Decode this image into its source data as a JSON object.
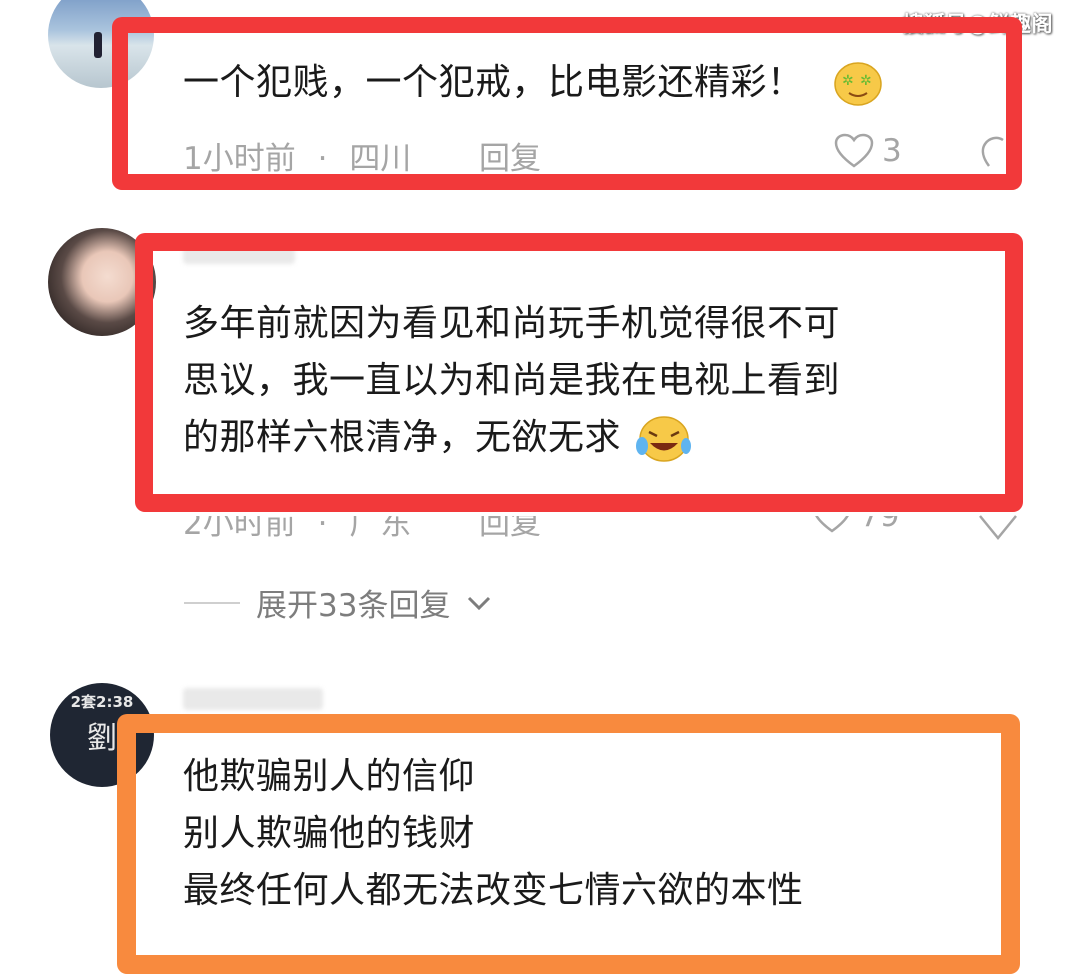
{
  "watermark": "搜狐号@鲜趣阁",
  "comments": [
    {
      "text": "一个犯贱，一个犯戒，比电影还精彩！",
      "time": "1小时前",
      "location": "四川",
      "reply_label": "回复",
      "likes": "3"
    },
    {
      "lines": [
        "多年前就因为看见和尚玩手机觉得很不可",
        "思议，我一直以为和尚是我在电视上看到",
        "的那样六根清净，无欲无求"
      ],
      "time": "2小时前",
      "location": "广东",
      "reply_label": "回复",
      "likes": "79"
    },
    {
      "lines": [
        "他欺骗别人的信仰",
        "别人欺骗他的钱财",
        "最终任何人都无法改变七情六欲的本性"
      ]
    }
  ],
  "expand_label": "展开33条回复",
  "avatar3": {
    "top_text": "2套2:38",
    "char": "劉"
  },
  "colors": {
    "highlight_red": "#f2393a",
    "highlight_orange": "#f88a3e",
    "meta_gray": "#a5a5a5"
  }
}
